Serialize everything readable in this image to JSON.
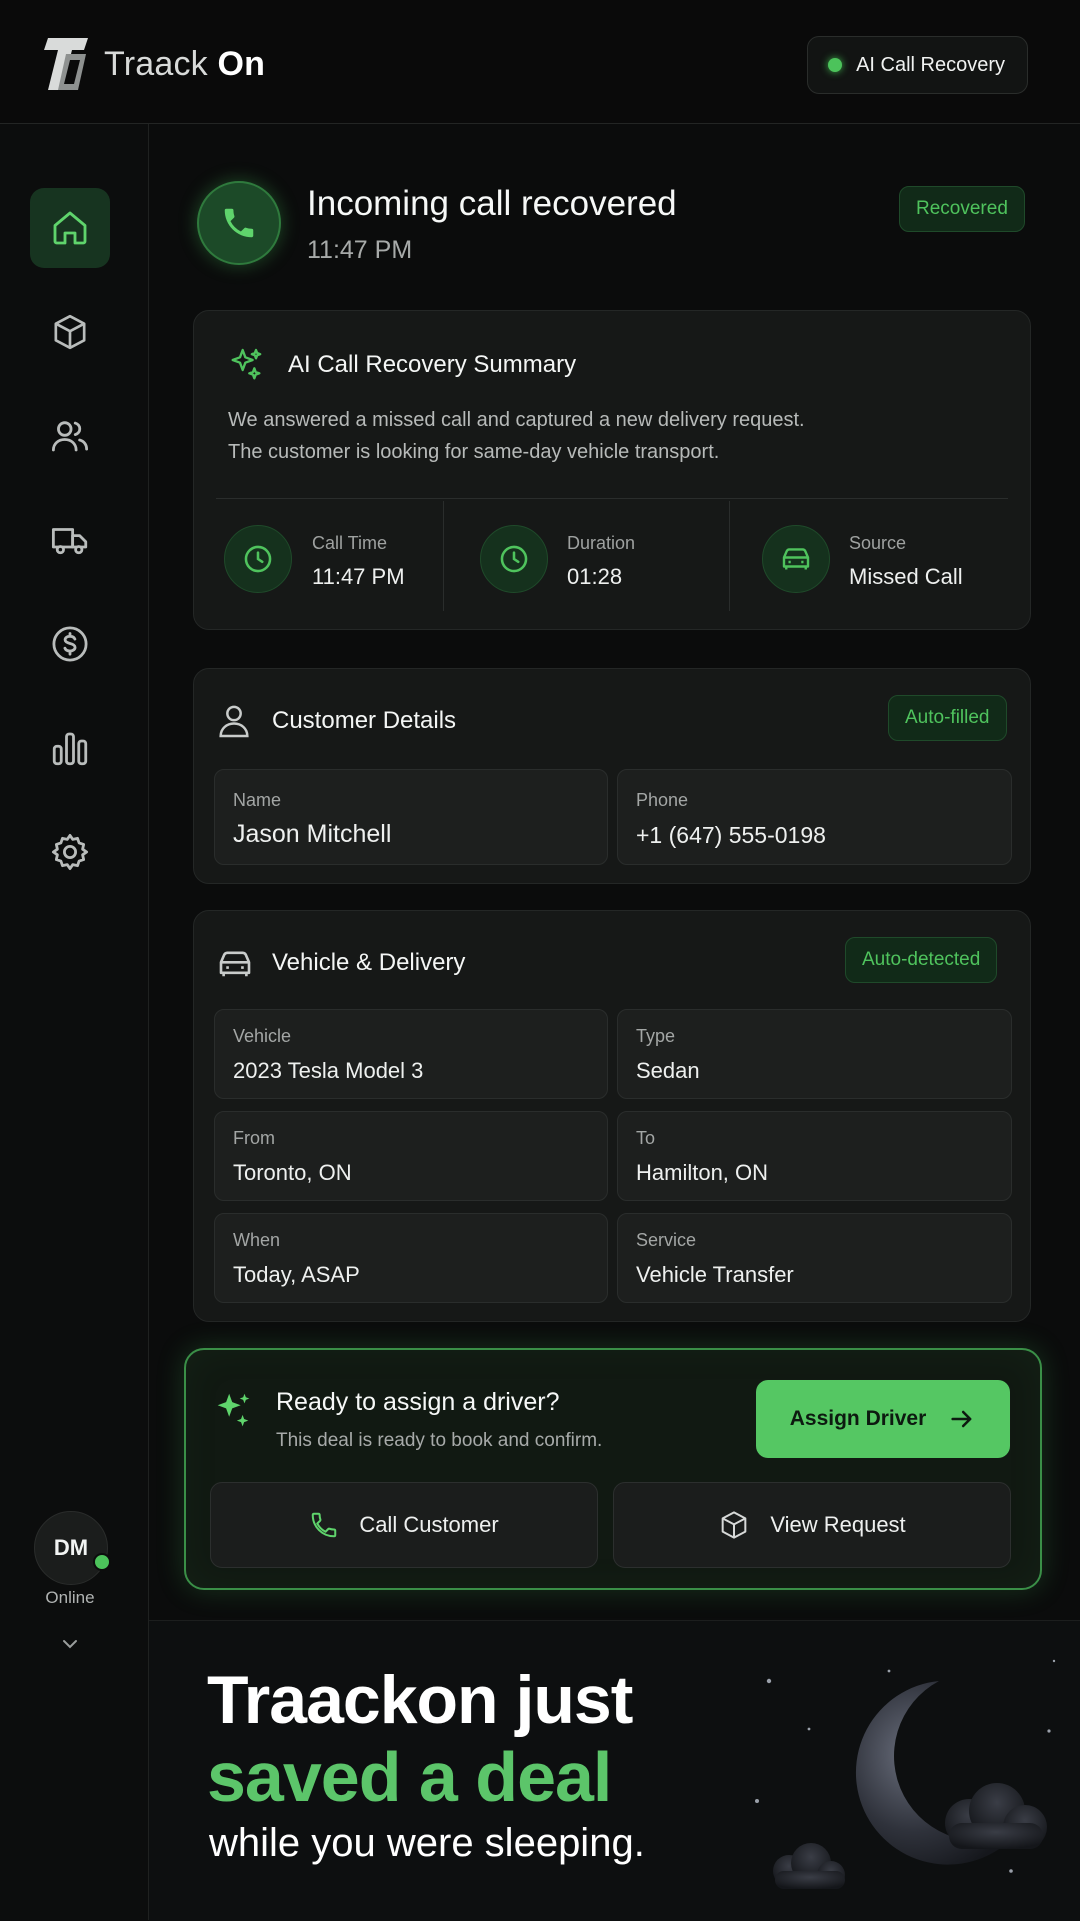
{
  "header": {
    "logo_text_light": "Traack",
    "logo_text_bold": "On",
    "status_label": "AI Call Recovery",
    "status_color": "#4cc35b"
  },
  "sidebar": {
    "items": [
      {
        "icon": "home-icon",
        "active": true
      },
      {
        "icon": "package-icon",
        "active": false
      },
      {
        "icon": "users-icon",
        "active": false
      },
      {
        "icon": "truck-icon",
        "active": false
      },
      {
        "icon": "dollar-icon",
        "active": false
      },
      {
        "icon": "bar-chart-icon",
        "active": false
      },
      {
        "icon": "gear-icon",
        "active": false
      }
    ],
    "user_initials": "DM",
    "user_status": "Online"
  },
  "call": {
    "title": "Incoming call recovered",
    "time": "11:47 PM",
    "badge": "Recovered"
  },
  "summary": {
    "title": "AI Call Recovery Summary",
    "line1": "We answered a missed call and captured a new delivery request.",
    "line2": "The customer is looking for same-day vehicle transport.",
    "metrics": [
      {
        "label": "Call Time",
        "value": "11:47 PM",
        "icon": "clock-icon"
      },
      {
        "label": "Duration",
        "value": "01:28",
        "icon": "clock-icon"
      },
      {
        "label": "Source",
        "value": "Missed Call",
        "icon": "car-icon"
      }
    ]
  },
  "customer": {
    "title": "Customer Details",
    "badge": "Auto-filled",
    "fields": [
      {
        "label": "Name",
        "value": "Jason Mitchell"
      },
      {
        "label": "Phone",
        "value": "+1 (647) 555-0198"
      }
    ]
  },
  "vehicle": {
    "title": "Vehicle & Delivery",
    "badge": "Auto-detected",
    "fields": [
      {
        "label": "Vehicle",
        "value": "2023 Tesla Model 3"
      },
      {
        "label": "Type",
        "value": "Sedan"
      },
      {
        "label": "From",
        "value": "Toronto, ON"
      },
      {
        "label": "To",
        "value": "Hamilton, ON"
      },
      {
        "label": "When",
        "value": "Today, ASAP"
      },
      {
        "label": "Service",
        "value": "Vehicle Transfer"
      }
    ]
  },
  "assign": {
    "title": "Ready to assign a driver?",
    "subtitle": "This deal is ready to book and confirm.",
    "primary_label": "Assign Driver",
    "call_label": "Call Customer",
    "view_label": "View Request"
  },
  "promo": {
    "line1": "Traackon just",
    "line2": "saved a deal",
    "line3": "while you were sleeping."
  },
  "colors": {
    "accent": "#55c763",
    "background": "#0b0c0c",
    "card": "#161817"
  }
}
